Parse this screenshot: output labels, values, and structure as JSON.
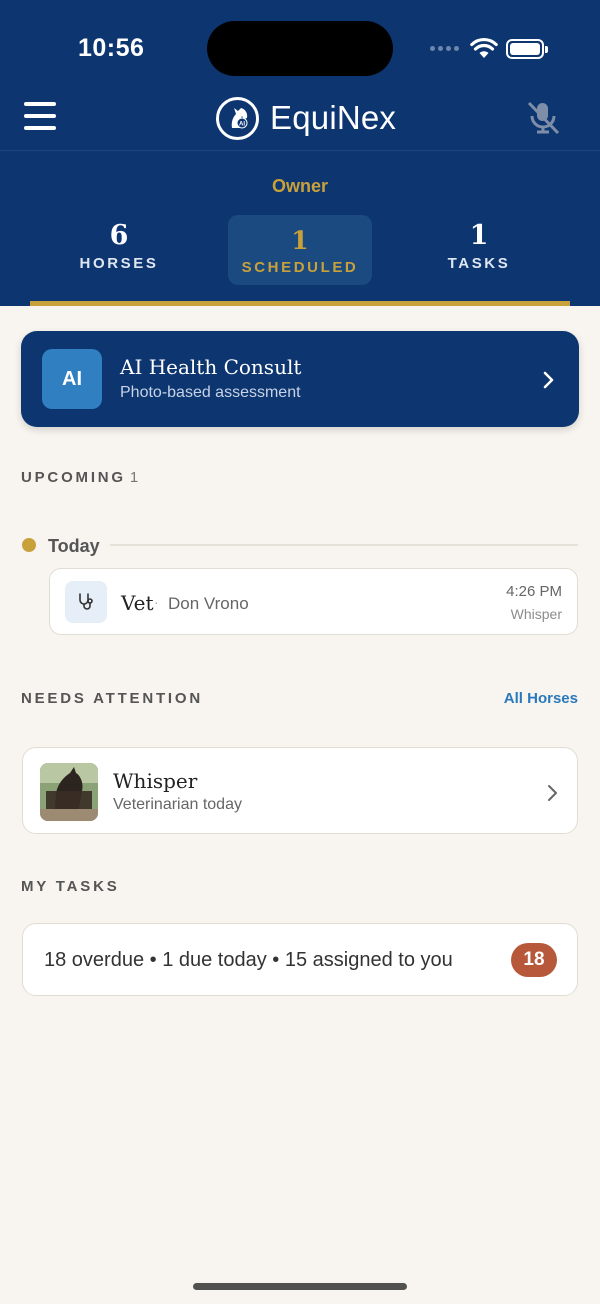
{
  "status_bar": {
    "time": "10:56"
  },
  "app": {
    "name": "EquiNex",
    "role": "Owner"
  },
  "stats": [
    {
      "value": "6",
      "label": "HORSES"
    },
    {
      "value": "1",
      "label": "SCHEDULED"
    },
    {
      "value": "1",
      "label": "TASKS"
    }
  ],
  "ai_consult": {
    "badge": "AI",
    "title": "AI Health Consult",
    "subtitle": "Photo-based assessment"
  },
  "upcoming": {
    "title": "UPCOMING",
    "count": "1",
    "day_label": "Today",
    "event": {
      "title": "Vet",
      "separator": "·",
      "person": "Don Vrono",
      "time": "4:26 PM",
      "horse": "Whisper"
    }
  },
  "needs_attention": {
    "title": "NEEDS ATTENTION",
    "link": "All Horses",
    "horse": {
      "name": "Whisper",
      "subtitle": "Veterinarian today"
    }
  },
  "my_tasks": {
    "title": "MY TASKS",
    "summary": "18 overdue • 1 due today • 15 assigned to you",
    "badge": "18"
  },
  "colors": {
    "navy": "#0d3570",
    "gold": "#c9a13a",
    "link": "#2a79bc",
    "badge": "#b8583a",
    "background": "#f8f5f0"
  }
}
